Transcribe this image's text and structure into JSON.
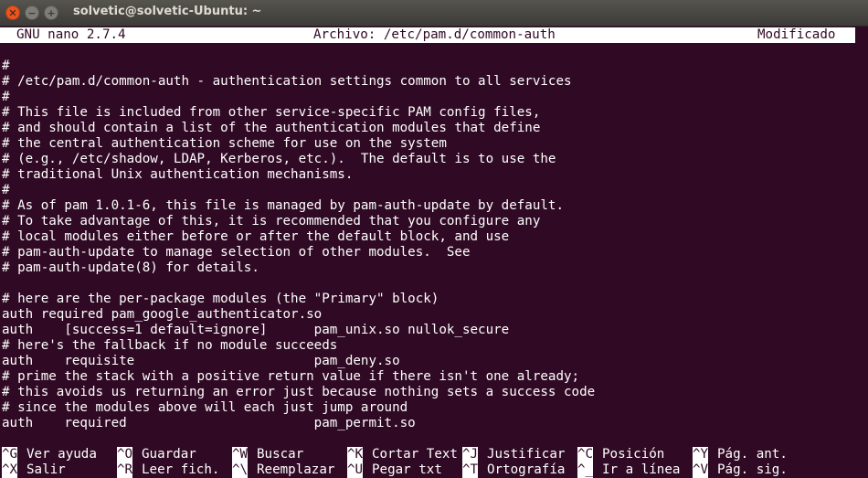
{
  "window": {
    "title": "solvetic@solvetic-Ubuntu: ~",
    "close_glyph": "✕",
    "minimize_glyph": "−",
    "maximize_glyph": "+"
  },
  "nano_header": {
    "version": "GNU nano 2.7.4",
    "file": "Archivo: /etc/pam.d/common-auth",
    "status": "Modificado"
  },
  "file_lines": [
    "#",
    "# /etc/pam.d/common-auth - authentication settings common to all services",
    "#",
    "# This file is included from other service-specific PAM config files,",
    "# and should contain a list of the authentication modules that define",
    "# the central authentication scheme for use on the system",
    "# (e.g., /etc/shadow, LDAP, Kerberos, etc.).  The default is to use the",
    "# traditional Unix authentication mechanisms.",
    "#",
    "# As of pam 1.0.1-6, this file is managed by pam-auth-update by default.",
    "# To take advantage of this, it is recommended that you configure any",
    "# local modules either before or after the default block, and use",
    "# pam-auth-update to manage selection of other modules.  See",
    "# pam-auth-update(8) for details.",
    "",
    "# here are the per-package modules (the \"Primary\" block)",
    "auth required pam_google_authenticator.so",
    "auth    [success=1 default=ignore]      pam_unix.so nullok_secure",
    "# here's the fallback if no module succeeds",
    "auth    requisite                       pam_deny.so",
    "# prime the stack with a positive return value if there isn't one already;",
    "# this avoids us returning an error just because nothing sets a success code",
    "# since the modules above will each just jump around",
    "auth    required                        pam_permit.so"
  ],
  "shortcuts": {
    "row1": [
      {
        "key": "^G",
        "label": "Ver ayuda"
      },
      {
        "key": "^O",
        "label": "Guardar"
      },
      {
        "key": "^W",
        "label": "Buscar"
      },
      {
        "key": "^K",
        "label": "Cortar Text"
      },
      {
        "key": "^J",
        "label": "Justificar"
      },
      {
        "key": "^C",
        "label": "Posición"
      },
      {
        "key": "^Y",
        "label": "Pág. ant."
      }
    ],
    "row2": [
      {
        "key": "^X",
        "label": "Salir"
      },
      {
        "key": "^R",
        "label": "Leer fich."
      },
      {
        "key": "^\\",
        "label": "Reemplazar"
      },
      {
        "key": "^U",
        "label": "Pegar txt"
      },
      {
        "key": "^T",
        "label": "Ortografía"
      },
      {
        "key": "^_",
        "label": "Ir a línea"
      },
      {
        "key": "^V",
        "label": "Pág. sig."
      }
    ]
  },
  "colors": {
    "terminal_bg": "#300a24",
    "terminal_fg": "#ffffff",
    "close_button": "#e95420"
  }
}
